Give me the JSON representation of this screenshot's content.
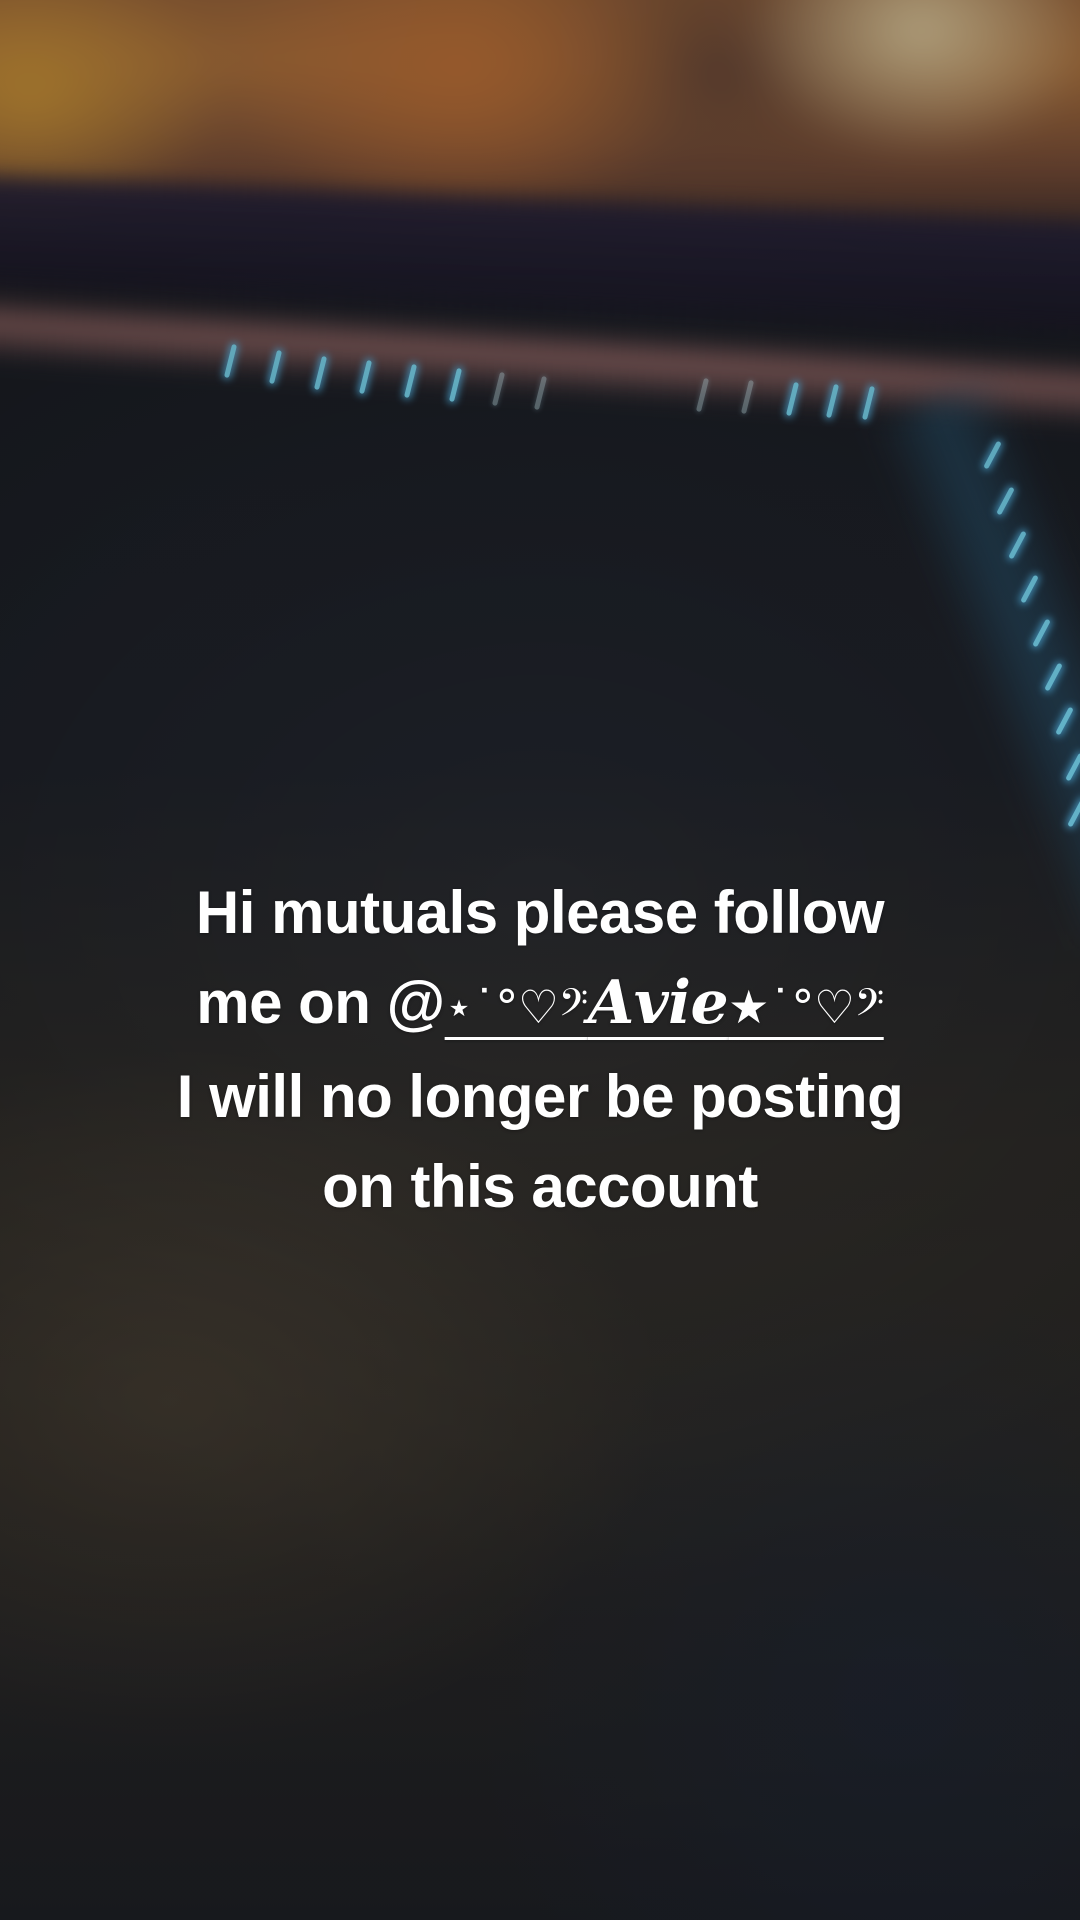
{
  "caption": {
    "line1": "Hi mutuals please follow",
    "line2_prefix": "me on @",
    "handle": {
      "deco_start": "⋆˙°♡𝄢",
      "name": "𝑨𝒗𝒊𝒆",
      "deco_end": "★˙°♡𝄢"
    },
    "line3": "I will no longer be posting",
    "line4": "on this account"
  },
  "colors": {
    "text": "#ffffff",
    "led_accent": "#7fe4ff",
    "warm_light": "#c8763a"
  }
}
